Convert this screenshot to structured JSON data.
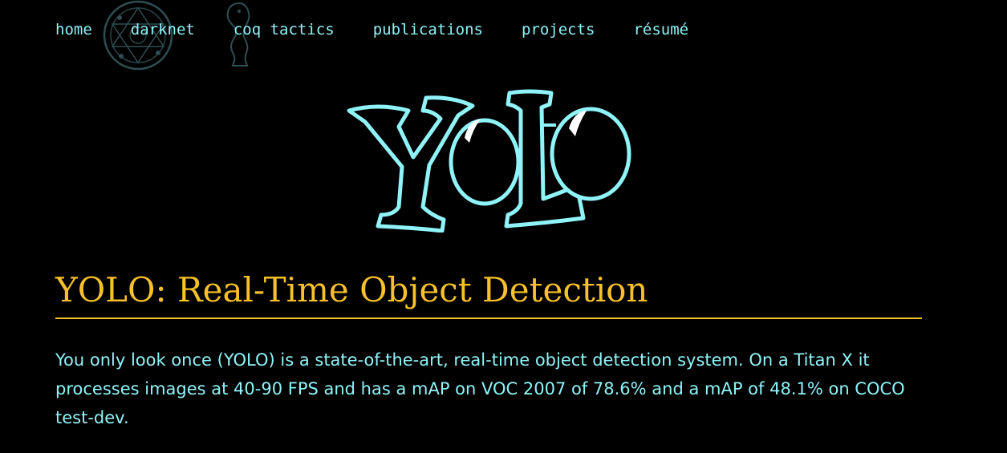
{
  "nav": {
    "items": [
      {
        "label": "home"
      },
      {
        "label": "darknet"
      },
      {
        "label": "coq tactics"
      },
      {
        "label": "publications"
      },
      {
        "label": "projects"
      },
      {
        "label": "résumé"
      }
    ]
  },
  "logo": {
    "text": "YOLO",
    "outline_color": "#8ff3f8",
    "fill_color": "#000000"
  },
  "main": {
    "title": "YOLO: Real-Time Object Detection",
    "intro": "You only look once (YOLO) is a state-of-the-art, real-time object detection system. On a Titan X it processes images at 40-90 FPS and has a mAP on VOC 2007 of 78.6% and a mAP of 48.1% on COCO test-dev."
  },
  "colors": {
    "background": "#000000",
    "link": "#8ff3f8",
    "heading": "#f6c12a"
  }
}
